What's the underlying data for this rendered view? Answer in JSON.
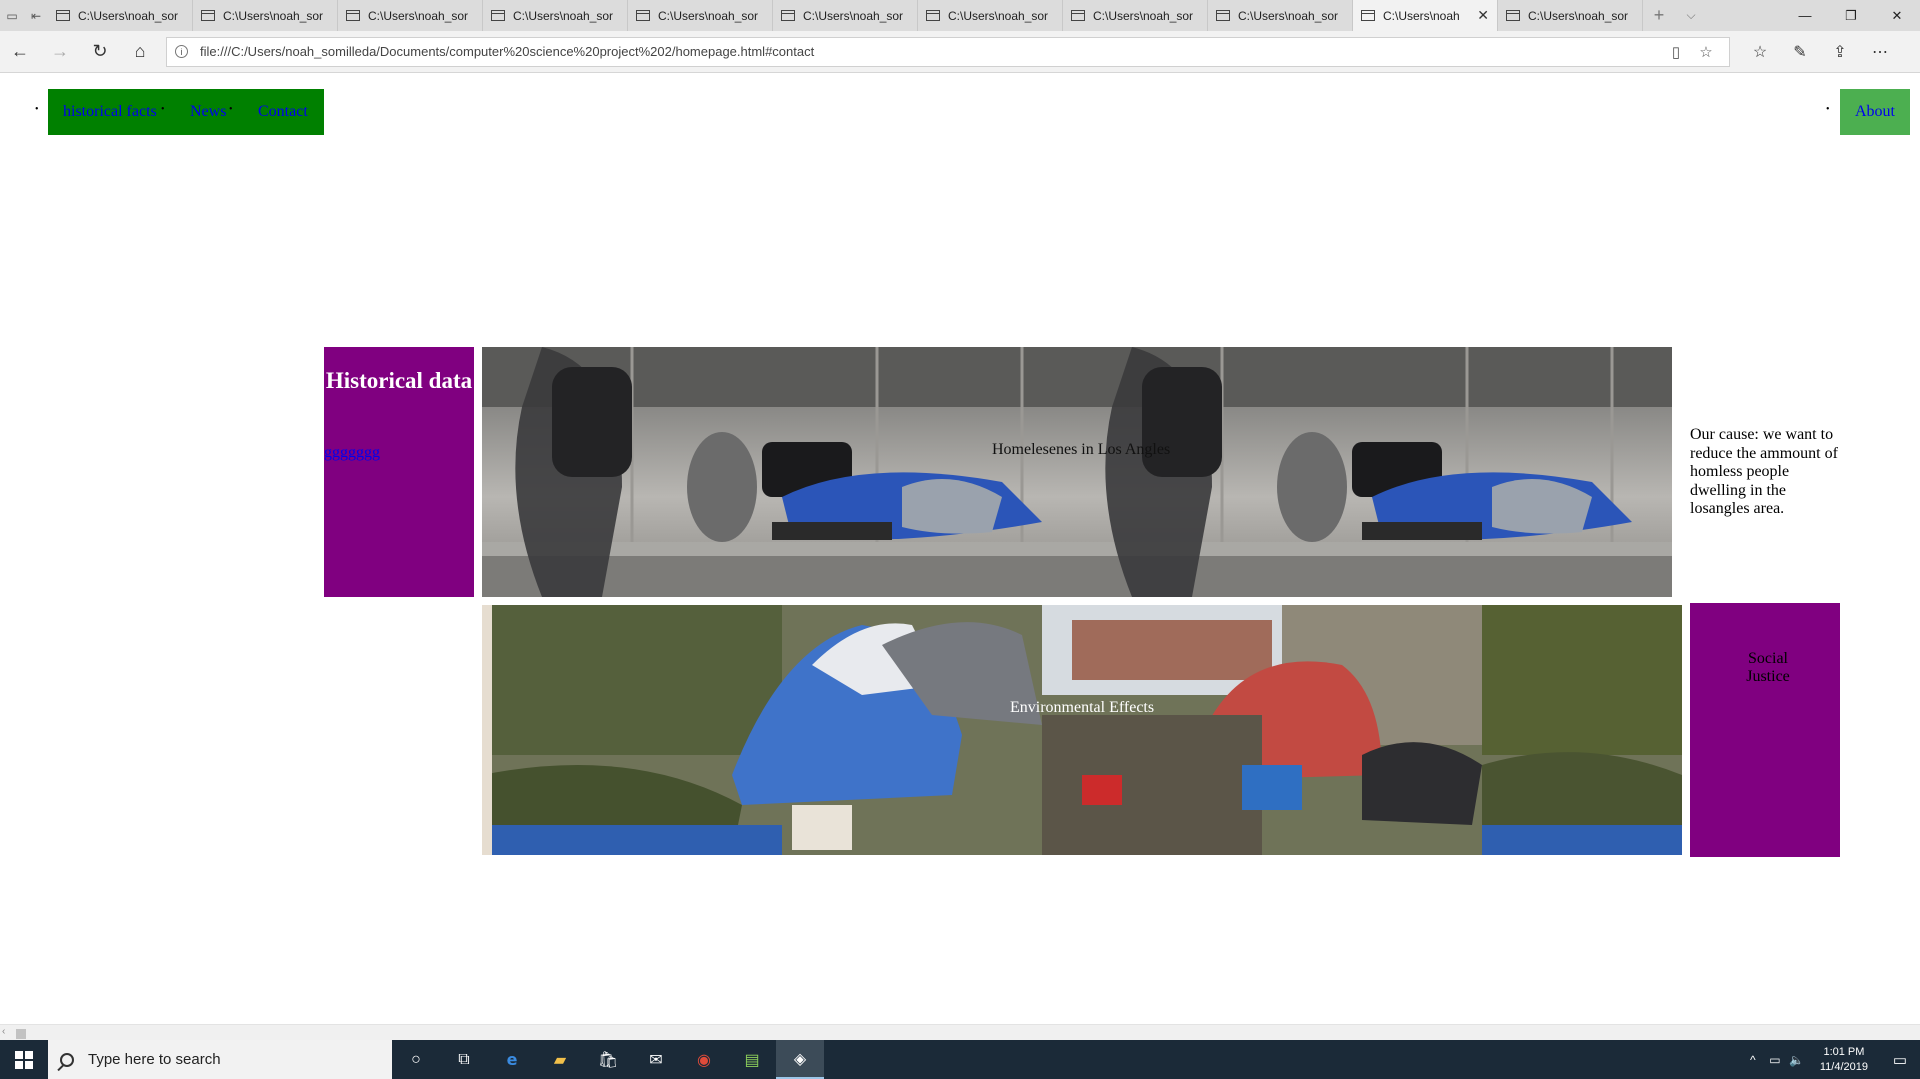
{
  "browser": {
    "tabs": [
      {
        "title": "C:\\Users\\noah_sor",
        "active": false
      },
      {
        "title": "C:\\Users\\noah_sor",
        "active": false
      },
      {
        "title": "C:\\Users\\noah_sor",
        "active": false
      },
      {
        "title": "C:\\Users\\noah_sor",
        "active": false
      },
      {
        "title": "C:\\Users\\noah_sor",
        "active": false
      },
      {
        "title": "C:\\Users\\noah_sor",
        "active": false
      },
      {
        "title": "C:\\Users\\noah_sor",
        "active": false
      },
      {
        "title": "C:\\Users\\noah_sor",
        "active": false
      },
      {
        "title": "C:\\Users\\noah_sor",
        "active": false
      },
      {
        "title": "C:\\Users\\noah",
        "active": true
      },
      {
        "title": "C:\\Users\\noah_sor",
        "active": false
      }
    ],
    "url": "file:///C:/Users/noah_somilleda/Documents/computer%20science%20project%202/homepage.html#contact"
  },
  "page": {
    "nav": {
      "links": [
        "historical facts",
        "News",
        "Contact"
      ],
      "about": "About"
    },
    "historical": {
      "title": "Historical data",
      "link": "ggggggg"
    },
    "photos": {
      "top_caption": "Homelesenes in Los Angles",
      "bottom_caption": "Environmental Effects"
    },
    "cause_text": "Our cause: we want to reduce the ammount of homless people dwelling in the losangles area.",
    "social_justice": "Social Justice"
  },
  "taskbar": {
    "search_placeholder": "Type here to search",
    "time": "1:01 PM",
    "date": "11/4/2019"
  },
  "colors": {
    "nav_green": "#008000",
    "about_green": "#4caf50",
    "purple": "#800080",
    "link_blue": "#0000ee"
  }
}
